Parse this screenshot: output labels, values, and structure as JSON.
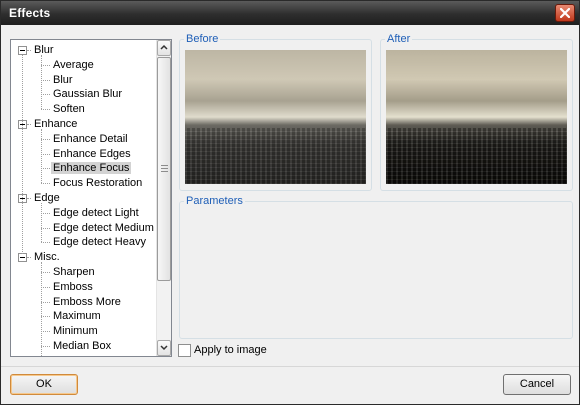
{
  "window": {
    "title": "Effects"
  },
  "tree": {
    "items": [
      {
        "label": "Blur",
        "level": 0
      },
      {
        "label": "Average",
        "level": 1
      },
      {
        "label": "Blur",
        "level": 1
      },
      {
        "label": "Gaussian Blur",
        "level": 1
      },
      {
        "label": "Soften",
        "level": 1
      },
      {
        "label": "Enhance",
        "level": 0
      },
      {
        "label": "Enhance Detail",
        "level": 1
      },
      {
        "label": "Enhance Edges",
        "level": 1
      },
      {
        "label": "Enhance Focus",
        "level": 1,
        "selected": true
      },
      {
        "label": "Focus Restoration",
        "level": 1
      },
      {
        "label": "Edge",
        "level": 0
      },
      {
        "label": "Edge detect Light",
        "level": 1
      },
      {
        "label": "Edge detect Medium",
        "level": 1
      },
      {
        "label": "Edge detect Heavy",
        "level": 1
      },
      {
        "label": "Misc.",
        "level": 0
      },
      {
        "label": "Sharpen",
        "level": 1
      },
      {
        "label": "Emboss",
        "level": 1
      },
      {
        "label": "Emboss More",
        "level": 1
      },
      {
        "label": "Maximum",
        "level": 1
      },
      {
        "label": "Minimum",
        "level": 1
      },
      {
        "label": "Median Box",
        "level": 1
      }
    ]
  },
  "before": {
    "label": "Before"
  },
  "after": {
    "label": "After"
  },
  "parameters": {
    "label": "Parameters"
  },
  "apply": {
    "label": "Apply to image",
    "checked": false
  },
  "buttons": {
    "ok": "OK",
    "cancel": "Cancel"
  },
  "colors": {
    "group_label": "#1f5fb7",
    "selection": "#d3d3d3",
    "close": "#c0381c"
  }
}
